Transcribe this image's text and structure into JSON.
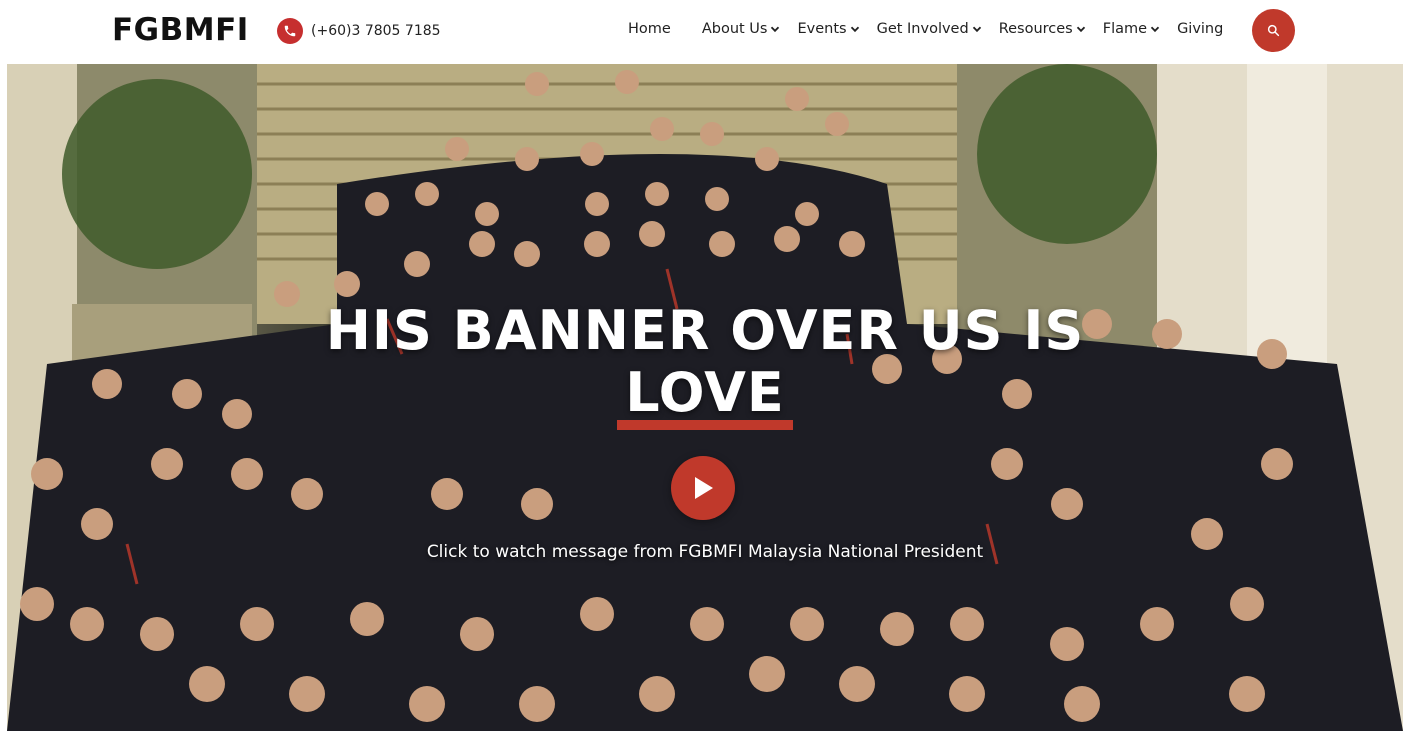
{
  "header": {
    "logo": "FGBMFI",
    "phone": "(+60)3 7805 7185",
    "phone_icon": "phone-icon",
    "search_icon": "search-icon",
    "accent_color": "#c0392b"
  },
  "nav": {
    "items": [
      {
        "label": "Home",
        "has_dropdown": false
      },
      {
        "label": "About Us",
        "has_dropdown": true
      },
      {
        "label": "Events",
        "has_dropdown": true
      },
      {
        "label": "Get Involved",
        "has_dropdown": true
      },
      {
        "label": "Resources",
        "has_dropdown": true
      },
      {
        "label": "Flame",
        "has_dropdown": true
      },
      {
        "label": "Giving",
        "has_dropdown": false
      }
    ]
  },
  "hero": {
    "title_line1": "HIS BANNER OVER US IS",
    "title_line2": "LOVE",
    "caption": "Click to watch message from FGBMFI Malaysia National President",
    "play_icon": "play-icon"
  }
}
